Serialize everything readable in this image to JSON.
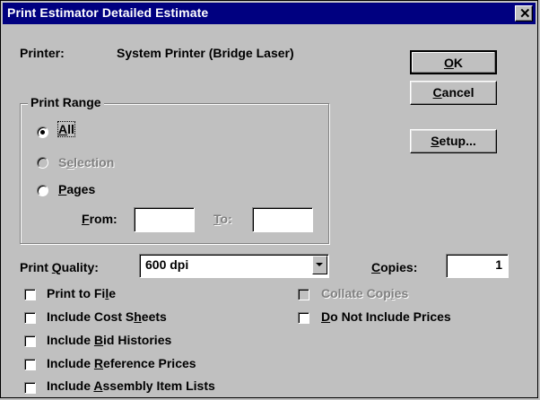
{
  "window": {
    "title": "Print Estimator Detailed Estimate",
    "close_glyph": "✕"
  },
  "printer": {
    "label": "Printer:",
    "value": "System Printer (Bridge Laser)"
  },
  "buttons": {
    "ok": {
      "pre": "",
      "u": "O",
      "post": "K"
    },
    "cancel": {
      "pre": "",
      "u": "C",
      "post": "ancel"
    },
    "setup": {
      "pre": "",
      "u": "S",
      "post": "etup..."
    }
  },
  "print_range": {
    "label": "Print Range",
    "all": {
      "pre": "",
      "u": "A",
      "post": "ll",
      "selected": true
    },
    "selection": {
      "pre": "S",
      "u": "e",
      "post": "lection",
      "enabled": false
    },
    "pages": {
      "pre": "",
      "u": "P",
      "post": "ages"
    },
    "from": {
      "pre": "",
      "u": "F",
      "post": "rom:",
      "value": ""
    },
    "to": {
      "pre": "",
      "u": "T",
      "post": "o:",
      "value": ""
    }
  },
  "quality": {
    "pre": "Print ",
    "u": "Q",
    "post": "uality:",
    "value": "600 dpi"
  },
  "copies": {
    "pre": "",
    "u": "C",
    "post": "opies:",
    "value": "1"
  },
  "options": [
    {
      "pre": "Print to Fi",
      "u": "l",
      "post": "e",
      "checked": false,
      "enabled": true
    },
    {
      "pre": "Include Cost S",
      "u": "h",
      "post": "eets",
      "checked": false,
      "enabled": true
    },
    {
      "pre": "Include ",
      "u": "B",
      "post": "id Histories",
      "checked": false,
      "enabled": true
    },
    {
      "pre": "Include ",
      "u": "R",
      "post": "eference Prices",
      "checked": false,
      "enabled": true
    },
    {
      "pre": "Include ",
      "u": "A",
      "post": "ssembly Item Lists",
      "checked": false,
      "enabled": true
    },
    {
      "pre": "Collate Cop",
      "u": "i",
      "post": "es",
      "checked": false,
      "enabled": false
    },
    {
      "pre": "",
      "u": "D",
      "post": "o Not Include Prices",
      "checked": false,
      "enabled": true
    }
  ]
}
